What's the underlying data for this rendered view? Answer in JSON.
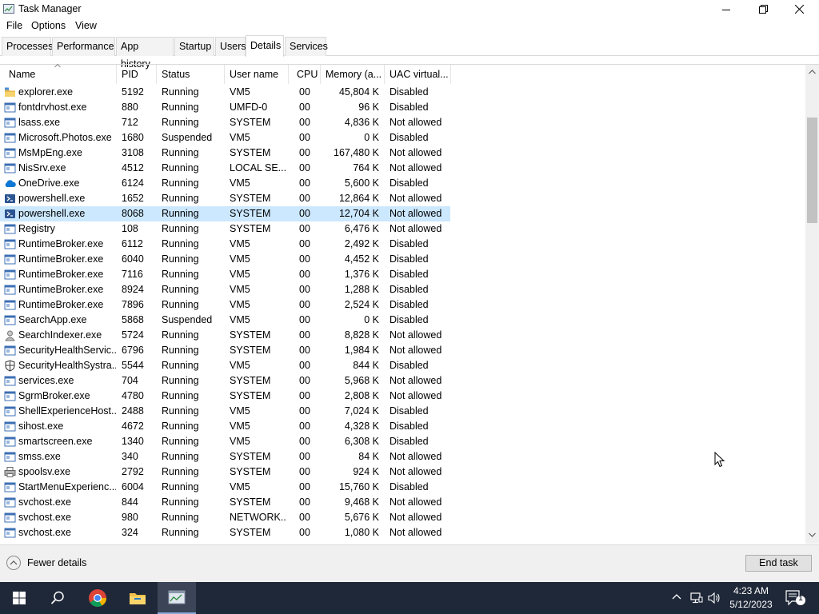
{
  "window": {
    "title": "Task Manager"
  },
  "menu": [
    "File",
    "Options",
    "View"
  ],
  "tabs": [
    "Processes",
    "Performance",
    "App history",
    "Startup",
    "Users",
    "Details",
    "Services"
  ],
  "active_tab": "Details",
  "columns": [
    "Name",
    "PID",
    "Status",
    "User name",
    "CPU",
    "Memory (a...",
    "UAC virtual..."
  ],
  "processes": [
    {
      "name": "explorer.exe",
      "pid": "5192",
      "status": "Running",
      "user": "VM5",
      "cpu": "00",
      "mem": "45,804 K",
      "uac": "Disabled",
      "icon": "folder-icon"
    },
    {
      "name": "fontdrvhost.exe",
      "pid": "880",
      "status": "Running",
      "user": "UMFD-0",
      "cpu": "00",
      "mem": "96 K",
      "uac": "Disabled",
      "icon": "app-icon"
    },
    {
      "name": "lsass.exe",
      "pid": "712",
      "status": "Running",
      "user": "SYSTEM",
      "cpu": "00",
      "mem": "4,836 K",
      "uac": "Not allowed",
      "icon": "app-icon"
    },
    {
      "name": "Microsoft.Photos.exe",
      "pid": "1680",
      "status": "Suspended",
      "user": "VM5",
      "cpu": "00",
      "mem": "0 K",
      "uac": "Disabled",
      "icon": "app-icon"
    },
    {
      "name": "MsMpEng.exe",
      "pid": "3108",
      "status": "Running",
      "user": "SYSTEM",
      "cpu": "00",
      "mem": "167,480 K",
      "uac": "Not allowed",
      "icon": "app-icon"
    },
    {
      "name": "NisSrv.exe",
      "pid": "4512",
      "status": "Running",
      "user": "LOCAL SE...",
      "cpu": "00",
      "mem": "764 K",
      "uac": "Not allowed",
      "icon": "app-icon"
    },
    {
      "name": "OneDrive.exe",
      "pid": "6124",
      "status": "Running",
      "user": "VM5",
      "cpu": "00",
      "mem": "5,600 K",
      "uac": "Disabled",
      "icon": "cloud-icon"
    },
    {
      "name": "powershell.exe",
      "pid": "1652",
      "status": "Running",
      "user": "SYSTEM",
      "cpu": "00",
      "mem": "12,864 K",
      "uac": "Not allowed",
      "icon": "powershell-icon"
    },
    {
      "name": "powershell.exe",
      "pid": "8068",
      "status": "Running",
      "user": "SYSTEM",
      "cpu": "00",
      "mem": "12,704 K",
      "uac": "Not allowed",
      "icon": "powershell-icon",
      "selected": true
    },
    {
      "name": "Registry",
      "pid": "108",
      "status": "Running",
      "user": "SYSTEM",
      "cpu": "00",
      "mem": "6,476 K",
      "uac": "Not allowed",
      "icon": "app-icon"
    },
    {
      "name": "RuntimeBroker.exe",
      "pid": "6112",
      "status": "Running",
      "user": "VM5",
      "cpu": "00",
      "mem": "2,492 K",
      "uac": "Disabled",
      "icon": "app-icon"
    },
    {
      "name": "RuntimeBroker.exe",
      "pid": "6040",
      "status": "Running",
      "user": "VM5",
      "cpu": "00",
      "mem": "4,452 K",
      "uac": "Disabled",
      "icon": "app-icon"
    },
    {
      "name": "RuntimeBroker.exe",
      "pid": "7116",
      "status": "Running",
      "user": "VM5",
      "cpu": "00",
      "mem": "1,376 K",
      "uac": "Disabled",
      "icon": "app-icon"
    },
    {
      "name": "RuntimeBroker.exe",
      "pid": "8924",
      "status": "Running",
      "user": "VM5",
      "cpu": "00",
      "mem": "1,288 K",
      "uac": "Disabled",
      "icon": "app-icon"
    },
    {
      "name": "RuntimeBroker.exe",
      "pid": "7896",
      "status": "Running",
      "user": "VM5",
      "cpu": "00",
      "mem": "2,524 K",
      "uac": "Disabled",
      "icon": "app-icon"
    },
    {
      "name": "SearchApp.exe",
      "pid": "5868",
      "status": "Suspended",
      "user": "VM5",
      "cpu": "00",
      "mem": "0 K",
      "uac": "Disabled",
      "icon": "app-icon"
    },
    {
      "name": "SearchIndexer.exe",
      "pid": "5724",
      "status": "Running",
      "user": "SYSTEM",
      "cpu": "00",
      "mem": "8,828 K",
      "uac": "Not allowed",
      "icon": "search-indexer-icon"
    },
    {
      "name": "SecurityHealthServic...",
      "pid": "6796",
      "status": "Running",
      "user": "SYSTEM",
      "cpu": "00",
      "mem": "1,984 K",
      "uac": "Not allowed",
      "icon": "app-icon"
    },
    {
      "name": "SecurityHealthSystra...",
      "pid": "5544",
      "status": "Running",
      "user": "VM5",
      "cpu": "00",
      "mem": "844 K",
      "uac": "Disabled",
      "icon": "shield-icon"
    },
    {
      "name": "services.exe",
      "pid": "704",
      "status": "Running",
      "user": "SYSTEM",
      "cpu": "00",
      "mem": "5,968 K",
      "uac": "Not allowed",
      "icon": "app-icon"
    },
    {
      "name": "SgrmBroker.exe",
      "pid": "4780",
      "status": "Running",
      "user": "SYSTEM",
      "cpu": "00",
      "mem": "2,808 K",
      "uac": "Not allowed",
      "icon": "app-icon"
    },
    {
      "name": "ShellExperienceHost....",
      "pid": "2488",
      "status": "Running",
      "user": "VM5",
      "cpu": "00",
      "mem": "7,024 K",
      "uac": "Disabled",
      "icon": "app-icon"
    },
    {
      "name": "sihost.exe",
      "pid": "4672",
      "status": "Running",
      "user": "VM5",
      "cpu": "00",
      "mem": "4,328 K",
      "uac": "Disabled",
      "icon": "app-icon"
    },
    {
      "name": "smartscreen.exe",
      "pid": "1340",
      "status": "Running",
      "user": "VM5",
      "cpu": "00",
      "mem": "6,308 K",
      "uac": "Disabled",
      "icon": "app-icon"
    },
    {
      "name": "smss.exe",
      "pid": "340",
      "status": "Running",
      "user": "SYSTEM",
      "cpu": "00",
      "mem": "84 K",
      "uac": "Not allowed",
      "icon": "app-icon"
    },
    {
      "name": "spoolsv.exe",
      "pid": "2792",
      "status": "Running",
      "user": "SYSTEM",
      "cpu": "00",
      "mem": "924 K",
      "uac": "Not allowed",
      "icon": "printer-icon"
    },
    {
      "name": "StartMenuExperienc...",
      "pid": "6004",
      "status": "Running",
      "user": "VM5",
      "cpu": "00",
      "mem": "15,760 K",
      "uac": "Disabled",
      "icon": "app-icon"
    },
    {
      "name": "svchost.exe",
      "pid": "844",
      "status": "Running",
      "user": "SYSTEM",
      "cpu": "00",
      "mem": "9,468 K",
      "uac": "Not allowed",
      "icon": "app-icon"
    },
    {
      "name": "svchost.exe",
      "pid": "980",
      "status": "Running",
      "user": "NETWORK...",
      "cpu": "00",
      "mem": "5,676 K",
      "uac": "Not allowed",
      "icon": "app-icon"
    },
    {
      "name": "svchost.exe",
      "pid": "324",
      "status": "Running",
      "user": "SYSTEM",
      "cpu": "00",
      "mem": "1,080 K",
      "uac": "Not allowed",
      "icon": "app-icon"
    }
  ],
  "footer": {
    "fewer_details": "Fewer details",
    "end_task": "End task"
  },
  "scrollbar": {
    "thumb_start_fraction": 0.11,
    "thumb_size_fraction": 0.22
  },
  "taskbar": {
    "apps": [
      "start-icon",
      "search-icon",
      "chrome-icon",
      "file-explorer-icon",
      "task-manager-icon"
    ],
    "time": "4:23 AM",
    "date": "5/12/2023",
    "notification_count": "1"
  },
  "colors": {
    "selected_row": "#cce8ff",
    "taskbar": "#1f2838",
    "accent": "#0078d7"
  }
}
